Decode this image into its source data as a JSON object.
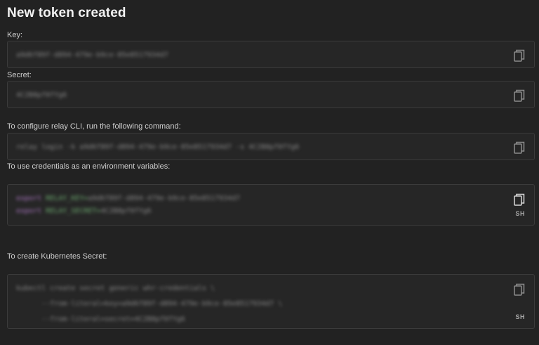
{
  "page": {
    "title": "New token created"
  },
  "fields": {
    "key": {
      "label": "Key:",
      "value": "a9d6f89f-d894-479e-b9ce-85e8517934d7"
    },
    "secret": {
      "label": "Secret:",
      "value": "4C2B8pf0fYg6"
    }
  },
  "cli": {
    "label": "To configure relay CLI, run the following command:",
    "command": "relay login -k a9d6f89f-d894-479e-b9ce-85e8517934d7 -s 4C2B8pf0fYg6"
  },
  "env": {
    "label": "To use credentials as an environment variables:",
    "lines": [
      {
        "keyword": "export",
        "var": "RELAY_KEY=",
        "value": "a9d6f89f-d894-479e-b9ce-85e8517934d7"
      },
      {
        "keyword": "export",
        "var": "RELAY_SECRET=",
        "value": "4C2B8pf0fYg6"
      }
    ],
    "lang": "SH"
  },
  "k8s": {
    "label": "To create Kubernetes Secret:",
    "lines": [
      "kubectl create secret generic whr-credentials \\",
      "      --from-literal=key=a9d6f89f-d894-479e-b9ce-85e8517934d7 \\",
      "      --from-literal=secret=4C2B8pf0fYg6"
    ],
    "lang": "SH"
  },
  "icons": {
    "copy": "copy-icon"
  },
  "colors": {
    "background": "#222222",
    "box_background": "#262626",
    "box_border": "#3b3b3b",
    "keyword": "#b07ac8",
    "variable": "#6fae72"
  }
}
